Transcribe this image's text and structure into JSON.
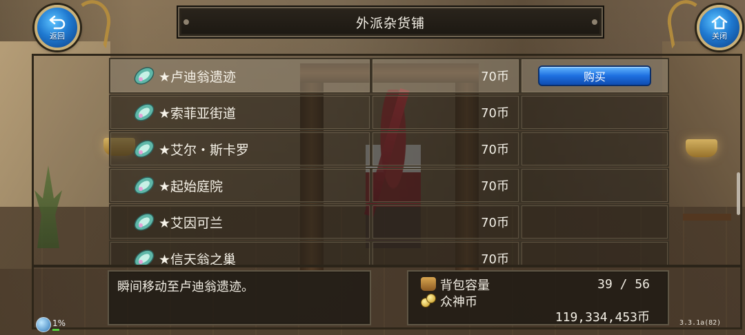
{
  "header": {
    "title": "外派杂货铺",
    "back_label": "返回",
    "close_label": "关闭"
  },
  "shop": {
    "items": [
      {
        "name": "★卢迪翁遗迹",
        "price": "70币",
        "icon": "crystal-wing-icon",
        "selected": true
      },
      {
        "name": "★索菲亚街道",
        "price": "70币",
        "icon": "crystal-wing-icon",
        "selected": false
      },
      {
        "name": "★艾尔・斯卡罗",
        "price": "70币",
        "icon": "crystal-wing-icon",
        "selected": false
      },
      {
        "name": "★起始庭院",
        "price": "70币",
        "icon": "crystal-wing-icon",
        "selected": false
      },
      {
        "name": "★艾因可兰",
        "price": "70币",
        "icon": "crystal-wing-icon",
        "selected": false
      },
      {
        "name": "★信天翁之巢",
        "price": "70币",
        "icon": "crystal-wing-icon",
        "selected": false
      }
    ],
    "buy_label": "购买"
  },
  "description": {
    "text": "瞬间移动至卢迪翁遗迹。"
  },
  "stats": {
    "bag_label": "背包容量",
    "bag_value": "39 / 56",
    "coin_label": "众神币",
    "coin_value": "119,334,453币"
  },
  "hud": {
    "percent": "1%",
    "version": "3.3.1a(82)"
  },
  "colors": {
    "buy_button": "#1e6fe0",
    "round_button": "#1f79d0",
    "panel_border": "#5f5645",
    "selected_row": "#968a76"
  }
}
